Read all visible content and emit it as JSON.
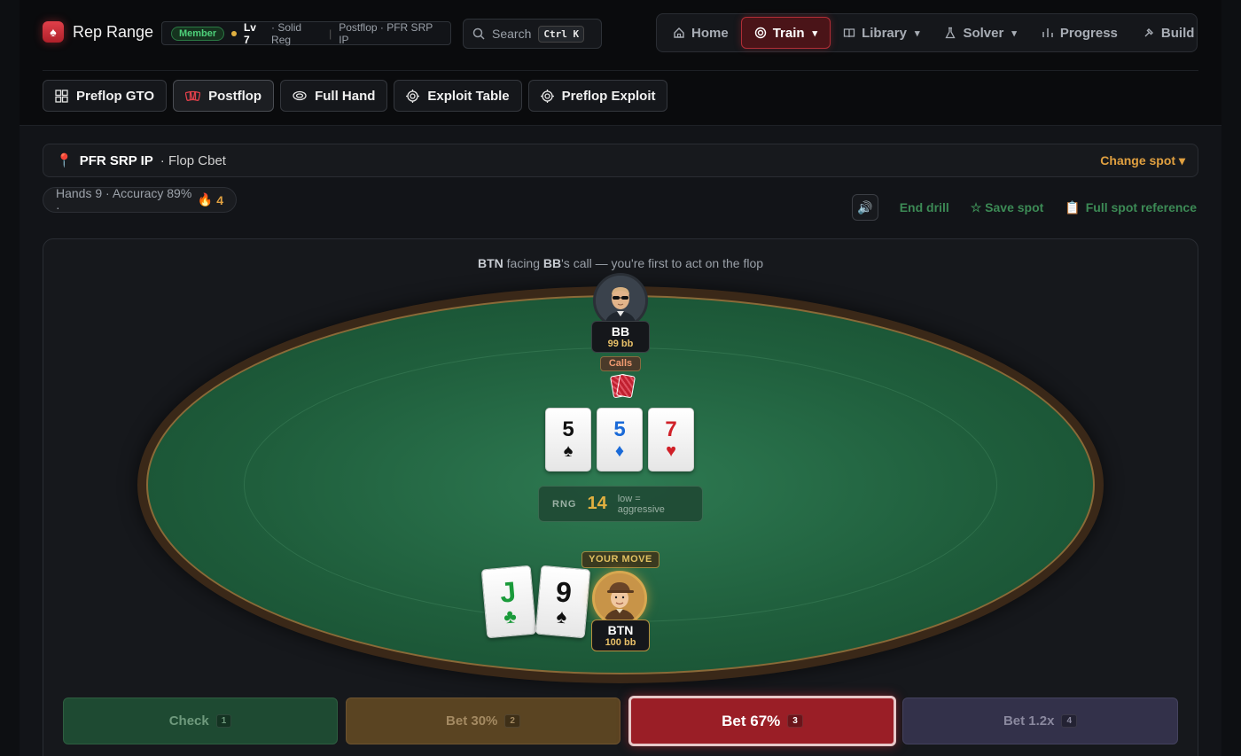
{
  "brand": {
    "name": "Rep Range"
  },
  "status": {
    "membership": "Member",
    "level": "Lv 7",
    "title": "· Solid Reg",
    "context": "Postflop · PFR SRP IP"
  },
  "search": {
    "label": "Search",
    "shortcut": "Ctrl K"
  },
  "nav": {
    "items": [
      {
        "label": "Home",
        "icon": "home-icon"
      },
      {
        "label": "Train",
        "icon": "target-icon",
        "caret": "▾"
      },
      {
        "label": "Library",
        "icon": "book-icon",
        "caret": "▾"
      },
      {
        "label": "Solver",
        "icon": "flask-icon",
        "caret": "▾"
      },
      {
        "label": "Progress",
        "icon": "bar-chart-icon"
      },
      {
        "label": "Build",
        "icon": "hammer-icon"
      }
    ],
    "active": "Train"
  },
  "subnav": {
    "items": [
      {
        "label": "Preflop GTO",
        "icon": "grid-icon"
      },
      {
        "label": "Postflop",
        "icon": "cards-icon"
      },
      {
        "label": "Full Hand",
        "icon": "chip-icon"
      },
      {
        "label": "Exploit Table",
        "icon": "crosshair-icon"
      },
      {
        "label": "Preflop Exploit",
        "icon": "crosshair-icon"
      }
    ],
    "active": "Postflop"
  },
  "spot": {
    "pin": "📍",
    "name": "PFR SRP IP",
    "street": "· Flop Cbet",
    "change_label": "Change spot ▾"
  },
  "stats": {
    "text": "Hands 9 · Accuracy 89% ·",
    "fire": "🔥",
    "streak": "4"
  },
  "actions": {
    "sound": "🔊",
    "end_drill": "End drill",
    "save_spot": "☆ Save spot",
    "reference_icon": "📋",
    "reference": "Full spot reference"
  },
  "situation": {
    "hero": "BTN",
    "mid1": " facing ",
    "villain": "BB",
    "mid2": "'s call — you're first to act on the flop"
  },
  "villain": {
    "position": "BB",
    "stack": "99 bb",
    "action": "Calls"
  },
  "hero": {
    "position": "BTN",
    "stack": "100 bb",
    "prompt": "YOUR MOVE"
  },
  "board": [
    {
      "rank": "5",
      "suit": "♠",
      "color": "#111111"
    },
    {
      "rank": "5",
      "suit": "♦",
      "color": "#1a6ad8"
    },
    {
      "rank": "7",
      "suit": "♥",
      "color": "#d02028"
    }
  ],
  "hole_cards": [
    {
      "rank": "J",
      "suit": "♣",
      "color": "#1a9a3a"
    },
    {
      "rank": "9",
      "suit": "♠",
      "color": "#111111"
    }
  ],
  "rng": {
    "label": "RNG",
    "value": "14",
    "hint": "low = aggressive"
  },
  "buttons": [
    {
      "label": "Check",
      "key": "1"
    },
    {
      "label": "Bet 30%",
      "key": "2"
    },
    {
      "label": "Bet 67%",
      "key": "3"
    },
    {
      "label": "Bet 1.2x",
      "key": "4"
    }
  ],
  "colors": {
    "accent_red": "#b02e36",
    "gold": "#e0a040",
    "felt": "#1f5e3c",
    "action_green": "#3c8a55"
  }
}
